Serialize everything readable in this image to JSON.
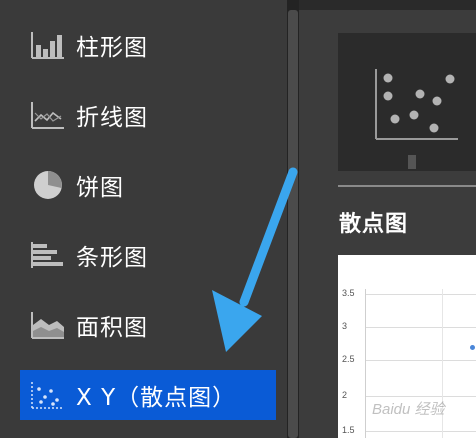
{
  "sidebar": {
    "items": [
      {
        "label": "柱形图",
        "icon": "bar-chart-icon"
      },
      {
        "label": "折线图",
        "icon": "line-chart-icon"
      },
      {
        "label": "饼图",
        "icon": "pie-chart-icon"
      },
      {
        "label": "条形图",
        "icon": "horizontal-bar-icon"
      },
      {
        "label": "面积图",
        "icon": "area-chart-icon"
      },
      {
        "label": "X Y（散点图）",
        "icon": "scatter-chart-icon",
        "selected": true
      }
    ]
  },
  "preview": {
    "title": "散点图",
    "y_ticks": [
      "3.5",
      "3",
      "2.5",
      "2",
      "1.5"
    ]
  },
  "watermark": "Baidu 经验",
  "colors": {
    "selected": "#0a5bd6",
    "arrow": "#3aa6ee",
    "sidebar_bg": "#3a3a3a"
  }
}
